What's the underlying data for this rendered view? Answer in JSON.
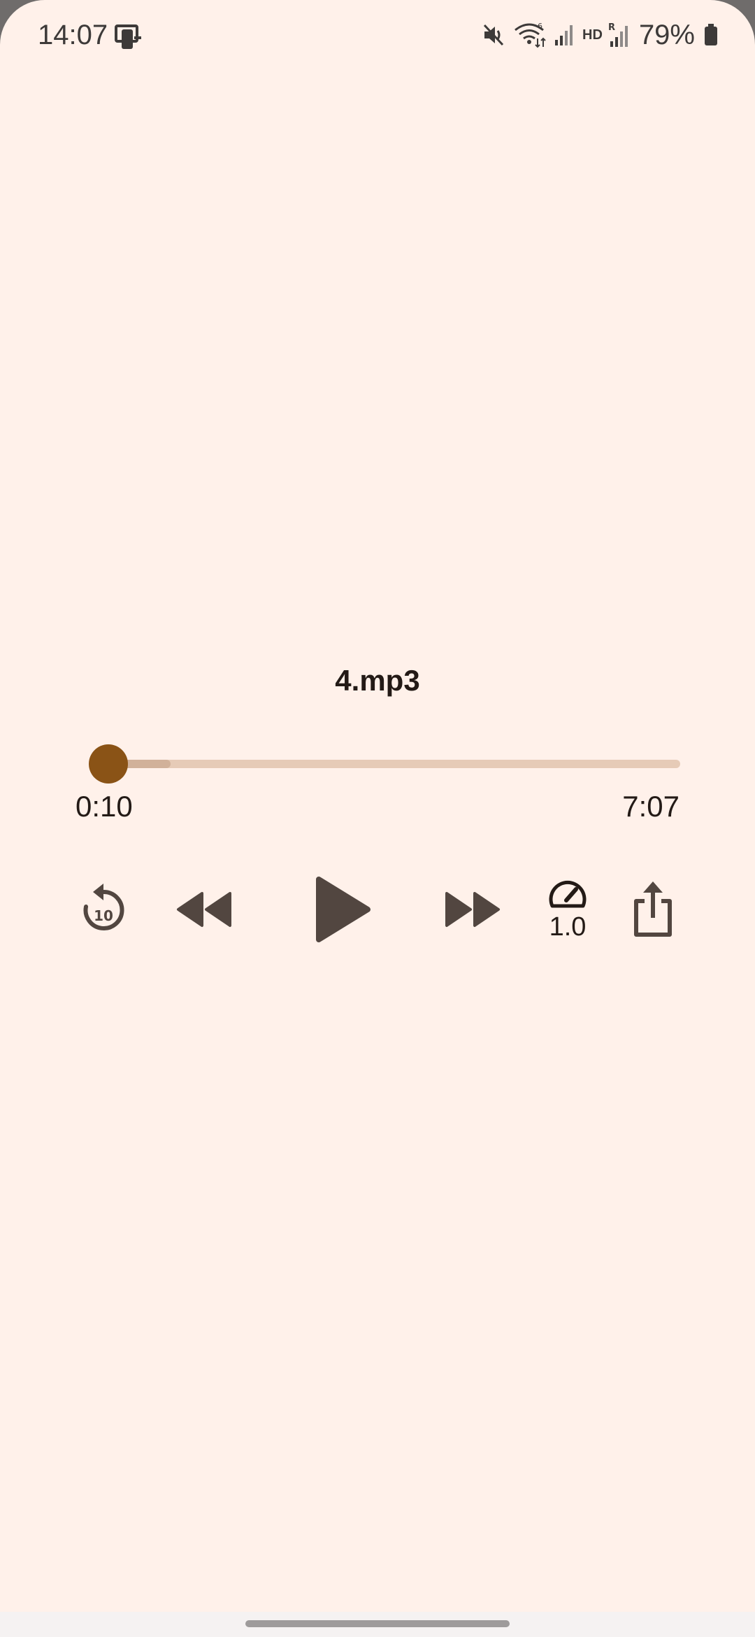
{
  "status_bar": {
    "time": "14:07",
    "hd_label": "HD",
    "battery_percent": "79%",
    "icons": [
      "screen-cast-icon",
      "mute-icon",
      "wifi-icon",
      "signal-icon",
      "roaming-signal-icon",
      "battery-icon"
    ]
  },
  "player": {
    "title": "4.mp3",
    "elapsed": "0:10",
    "duration": "7:07",
    "progress_fraction": 0.0234,
    "buffered_fraction": 0.13,
    "speed": "1.0",
    "replay_seconds": "10"
  },
  "colors": {
    "background": "#fff1ea",
    "accent": "#8a5316",
    "track": "#e6cbb7",
    "icon": "#524640"
  }
}
